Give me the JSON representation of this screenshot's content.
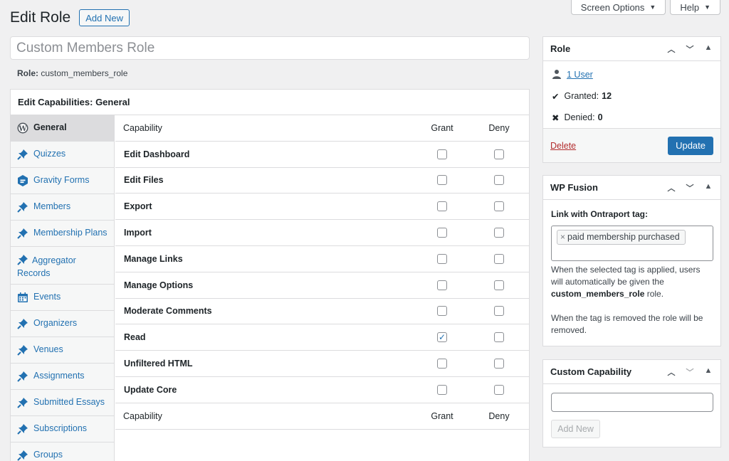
{
  "screen_meta": {
    "screen_options": "Screen Options",
    "help": "Help"
  },
  "header": {
    "title": "Edit Role",
    "add_new": "Add New"
  },
  "role_title_value": "Custom Members Role",
  "role_slug": {
    "label": "Role:",
    "value": "custom_members_role"
  },
  "capabilities": {
    "heading": "Edit Capabilities: General",
    "sidebar": [
      {
        "label": "General",
        "icon": "wordpress-icon",
        "active": true
      },
      {
        "label": "Quizzes",
        "icon": "pin-icon"
      },
      {
        "label": "Gravity Forms",
        "icon": "gravity-forms-icon"
      },
      {
        "label": "Members",
        "icon": "pin-icon"
      },
      {
        "label": "Membership Plans",
        "icon": "pin-icon"
      },
      {
        "label": "Aggregator Records",
        "icon": "pin-icon"
      },
      {
        "label": "Events",
        "icon": "calendar-icon"
      },
      {
        "label": "Organizers",
        "icon": "pin-icon"
      },
      {
        "label": "Venues",
        "icon": "pin-icon"
      },
      {
        "label": "Assignments",
        "icon": "pin-icon"
      },
      {
        "label": "Submitted Essays",
        "icon": "pin-icon"
      },
      {
        "label": "Subscriptions",
        "icon": "pin-icon"
      },
      {
        "label": "Groups",
        "icon": "pin-icon"
      }
    ],
    "columns": {
      "capability": "Capability",
      "grant": "Grant",
      "deny": "Deny"
    },
    "rows": [
      {
        "name": "Edit Dashboard",
        "grant": false,
        "deny": false
      },
      {
        "name": "Edit Files",
        "grant": false,
        "deny": false
      },
      {
        "name": "Export",
        "grant": false,
        "deny": false
      },
      {
        "name": "Import",
        "grant": false,
        "deny": false
      },
      {
        "name": "Manage Links",
        "grant": false,
        "deny": false
      },
      {
        "name": "Manage Options",
        "grant": false,
        "deny": false
      },
      {
        "name": "Moderate Comments",
        "grant": false,
        "deny": false
      },
      {
        "name": "Read",
        "grant": true,
        "deny": false
      },
      {
        "name": "Unfiltered HTML",
        "grant": false,
        "deny": false
      },
      {
        "name": "Update Core",
        "grant": false,
        "deny": false
      }
    ]
  },
  "role_box": {
    "title": "Role",
    "users_link": "1 User",
    "granted_label": "Granted:",
    "granted_count": "12",
    "denied_label": "Denied:",
    "denied_count": "0",
    "delete": "Delete",
    "update": "Update"
  },
  "fusion_box": {
    "title": "WP Fusion",
    "label": "Link with Ontraport tag:",
    "tag": "paid membership purchased",
    "desc1_a": "When the selected tag is applied, users will automatically be given the ",
    "desc1_role": "custom_members_role",
    "desc1_b": " role.",
    "desc2": "When the tag is removed the role will be removed."
  },
  "custom_box": {
    "title": "Custom Capability",
    "button": "Add New",
    "input_value": ""
  },
  "colors": {
    "accent": "#2271b1",
    "danger": "#b32d2e",
    "background": "#f0f0f1"
  }
}
